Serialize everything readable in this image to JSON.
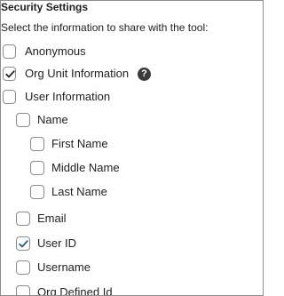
{
  "header": {
    "title": "Security Settings",
    "instructions": "Select the information to share with the tool:"
  },
  "options": {
    "anonymous": {
      "label": "Anonymous",
      "checked": false
    },
    "org_unit_information": {
      "label": "Org Unit Information",
      "checked": true,
      "help_icon": "question-mark-icon"
    },
    "user_information": {
      "label": "User Information",
      "checked": false
    },
    "name": {
      "label": "Name",
      "checked": false
    },
    "first_name": {
      "label": "First Name",
      "checked": false
    },
    "middle_name": {
      "label": "Middle Name",
      "checked": false
    },
    "last_name": {
      "label": "Last Name",
      "checked": false
    },
    "email": {
      "label": "Email",
      "checked": false
    },
    "user_id": {
      "label": "User ID",
      "checked": true
    },
    "username": {
      "label": "Username",
      "checked": false
    },
    "org_defined_id": {
      "label": "Org Defined Id",
      "checked": false
    }
  },
  "colors": {
    "text": "#202122",
    "checkbox_border": "#8b8b8b",
    "check_mark": "#202122",
    "user_id_check_mark": "#1f5b99",
    "frame_border": "#8c8c8c"
  }
}
